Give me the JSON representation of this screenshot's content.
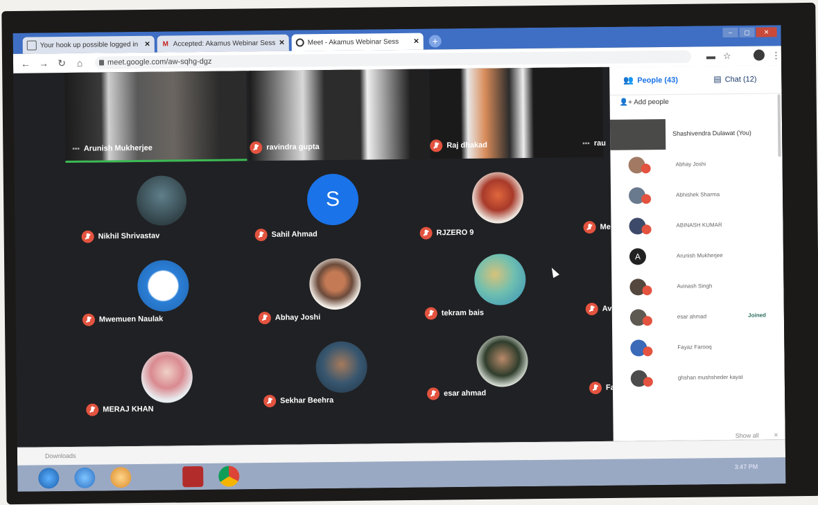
{
  "browser": {
    "tabs": [
      {
        "label": "Your hook up possible logged in",
        "favicon": "doc-icon",
        "active": false
      },
      {
        "label": "Accepted: Akamus Webinar Sess",
        "favicon": "gmail-icon",
        "active": false
      },
      {
        "label": "Meet - Akamus Webinar Sess",
        "favicon": "meet-icon",
        "active": true
      }
    ],
    "new_tab": "+",
    "url": "meet.google.com/aw-sqhg-dgz",
    "accent": "#3f6fc4"
  },
  "meet": {
    "top_row": [
      {
        "name": "Arunish Mukherjee"
      },
      {
        "name": "ravindra gupta"
      },
      {
        "name": "Raj dhakad"
      },
      {
        "name": "rau"
      }
    ],
    "grid": [
      {
        "name": "Nikhil Shrivastav"
      },
      {
        "name": "Sahil Ahmad",
        "letter": "S"
      },
      {
        "name": "RJZERO 9"
      },
      {
        "name": "Me"
      },
      {
        "name": "Mwemuen Naulak"
      },
      {
        "name": "Abhay Joshi"
      },
      {
        "name": "tekram bais"
      },
      {
        "name": "Av"
      },
      {
        "name": "MERAJ KHAN"
      },
      {
        "name": "Sekhar Beehra"
      },
      {
        "name": "esar ahmad"
      },
      {
        "name": "Fa"
      }
    ]
  },
  "panel": {
    "people_tab": "People (43)",
    "chat_tab": "Chat (12)",
    "add_people": "Add people",
    "you": "Shashivendra Dulawat (You)",
    "people": [
      {
        "name": "Abhay  Joshi"
      },
      {
        "name": "Abhishek Sharma"
      },
      {
        "name": "ABINASH KUMAR"
      },
      {
        "name": "Arunish Mukherjee",
        "letter": "A"
      },
      {
        "name": "Avinash Singh"
      },
      {
        "name": "esar ahmad",
        "status": "Joined"
      },
      {
        "name": "Fayaz Farooq"
      },
      {
        "name": "ghshan mushsheder kayat"
      }
    ]
  },
  "notification": {
    "text": "Downloads",
    "show_all": "Show all",
    "close": "×"
  },
  "taskbar": {
    "time": "3:47 PM"
  }
}
